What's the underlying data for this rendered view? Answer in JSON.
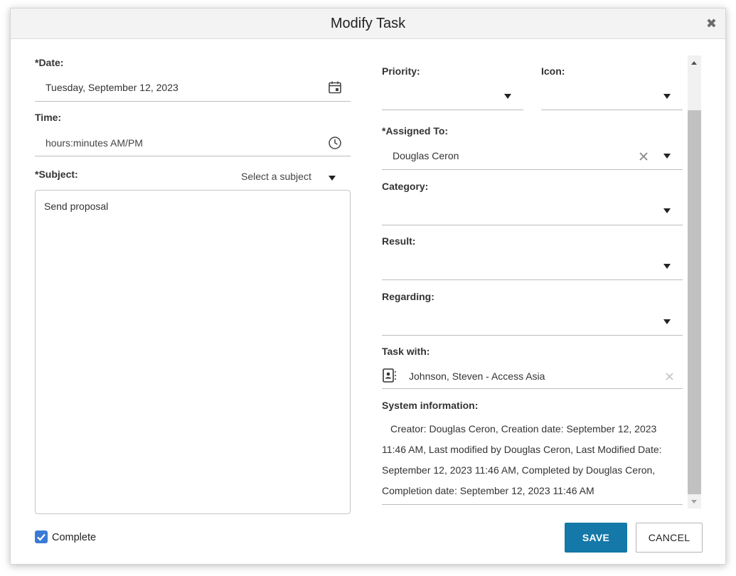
{
  "dialog": {
    "title": "Modify Task",
    "close_symbol": "✖"
  },
  "left": {
    "date": {
      "label": "*Date:",
      "value": "Tuesday, September 12, 2023",
      "icon": "calendar-icon"
    },
    "time": {
      "label": "Time:",
      "placeholder": "hours:minutes AM/PM",
      "icon": "clock-icon"
    },
    "subject": {
      "label": "*Subject:",
      "select_placeholder": "Select a subject",
      "text": "Send proposal"
    }
  },
  "right": {
    "priority": {
      "label": "Priority:",
      "value": ""
    },
    "icon_field": {
      "label": "Icon:",
      "value": ""
    },
    "assigned_to": {
      "label": "*Assigned To:",
      "value": "Douglas Ceron"
    },
    "category": {
      "label": "Category:",
      "value": ""
    },
    "result": {
      "label": "Result:",
      "value": ""
    },
    "regarding": {
      "label": "Regarding:",
      "value": ""
    },
    "task_with": {
      "label": "Task with:",
      "value": "Johnson, Steven - Access Asia",
      "icon": "contact-card-icon"
    },
    "system_information": {
      "label": "System information:",
      "text": "Creator: Douglas Ceron, Creation date: September 12, 2023 11:46 AM, Last modified by Douglas Ceron, Last Modified Date: September 12, 2023 11:46 AM, Completed by Douglas Ceron, Completion date: September 12, 2023 11:46 AM"
    }
  },
  "footer": {
    "complete_label": "Complete",
    "complete_checked": true,
    "save_label": "SAVE",
    "cancel_label": "CANCEL"
  },
  "colors": {
    "save_button": "#1478a8",
    "checkbox": "#3a7bd5"
  }
}
